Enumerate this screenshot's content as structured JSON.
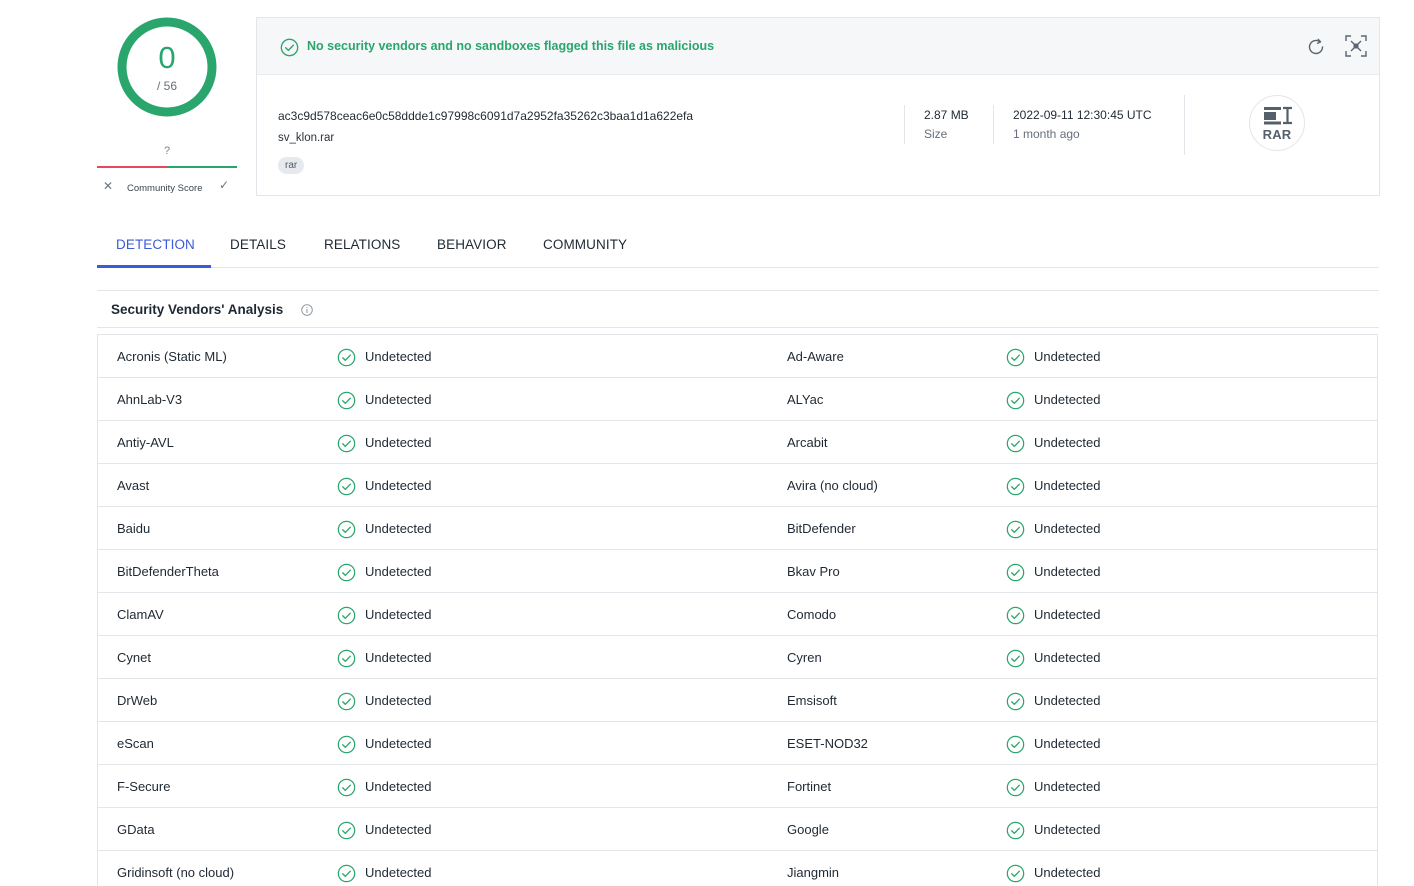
{
  "score": {
    "detections": "0",
    "total": "/ 56",
    "community_value": "?",
    "community_label": "Community Score",
    "vote_down": "✕",
    "vote_up": "✓"
  },
  "file": {
    "verdict": "No security vendors and no sandboxes flagged this file as malicious",
    "sha256": "ac3c9d578ceac6e0c58ddde1c97998c6091d7a2952fa35262c3baa1d1a622efa",
    "name": "sv_klon.rar",
    "tag": "rar",
    "size_value": "2.87 MB",
    "size_label": "Size",
    "date_value": "2022-09-11 12:30:45 UTC",
    "date_relative": "1 month ago",
    "type_badge": "RAR"
  },
  "tabs": [
    "DETECTION",
    "DETAILS",
    "RELATIONS",
    "BEHAVIOR",
    "COMMUNITY"
  ],
  "section_title": "Security Vendors' Analysis",
  "colors": {
    "accent": "#3c5bd6",
    "clean": "#2aa66d",
    "malicious": "#e44a5b"
  },
  "rows": [
    {
      "left": "Acronis (Static ML)",
      "left_result": "Undetected",
      "right": "Ad-Aware",
      "right_result": "Undetected"
    },
    {
      "left": "AhnLab-V3",
      "left_result": "Undetected",
      "right": "ALYac",
      "right_result": "Undetected"
    },
    {
      "left": "Antiy-AVL",
      "left_result": "Undetected",
      "right": "Arcabit",
      "right_result": "Undetected"
    },
    {
      "left": "Avast",
      "left_result": "Undetected",
      "right": "Avira (no cloud)",
      "right_result": "Undetected"
    },
    {
      "left": "Baidu",
      "left_result": "Undetected",
      "right": "BitDefender",
      "right_result": "Undetected"
    },
    {
      "left": "BitDefenderTheta",
      "left_result": "Undetected",
      "right": "Bkav Pro",
      "right_result": "Undetected"
    },
    {
      "left": "ClamAV",
      "left_result": "Undetected",
      "right": "Comodo",
      "right_result": "Undetected"
    },
    {
      "left": "Cynet",
      "left_result": "Undetected",
      "right": "Cyren",
      "right_result": "Undetected"
    },
    {
      "left": "DrWeb",
      "left_result": "Undetected",
      "right": "Emsisoft",
      "right_result": "Undetected"
    },
    {
      "left": "eScan",
      "left_result": "Undetected",
      "right": "ESET-NOD32",
      "right_result": "Undetected"
    },
    {
      "left": "F-Secure",
      "left_result": "Undetected",
      "right": "Fortinet",
      "right_result": "Undetected"
    },
    {
      "left": "GData",
      "left_result": "Undetected",
      "right": "Google",
      "right_result": "Undetected"
    },
    {
      "left": "Gridinsoft (no cloud)",
      "left_result": "Undetected",
      "right": "Jiangmin",
      "right_result": "Undetected"
    }
  ]
}
